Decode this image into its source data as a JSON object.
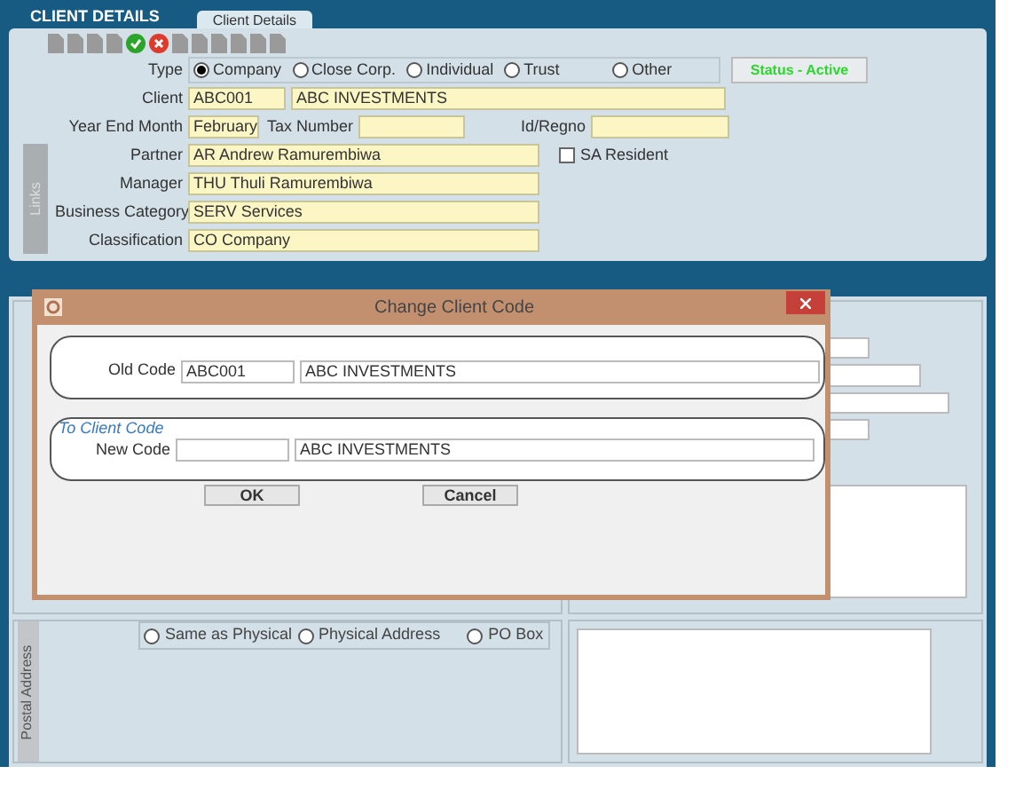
{
  "header": {
    "title": "CLIENT DETAILS",
    "tab": "Client Details"
  },
  "client_form": {
    "type_label": "Type",
    "type_options": [
      {
        "label": "Company",
        "selected": true
      },
      {
        "label": "Close Corp.",
        "selected": false
      },
      {
        "label": "Individual",
        "selected": false
      },
      {
        "label": "Trust",
        "selected": false
      },
      {
        "label": "Other",
        "selected": false
      }
    ],
    "status": "Status - Active",
    "client_label": "Client",
    "client_code": "ABC001",
    "client_name": "ABC INVESTMENTS",
    "year_end_label": "Year End Month",
    "year_end": "February",
    "tax_number_label": "Tax Number",
    "id_label": "Id/Regno",
    "partner_label": "Partner",
    "partner": "AR Andrew Ramurembiwa",
    "sa_resident": {
      "label": "SA Resident",
      "checked": false
    },
    "manager_label": "Manager",
    "manager": "THU Thuli Ramurembiwa",
    "category_label": "Business Category",
    "category": "SERV Services",
    "classification_label": "Classification",
    "classification": "CO Company",
    "links": "Links"
  },
  "dialog": {
    "title": "Change Client Code",
    "old_code_label": "Old Code",
    "old_code": "ABC001",
    "old_name": "ABC INVESTMENTS",
    "section_title": "To Client Code",
    "new_code_label": "New Code",
    "new_name": "ABC INVESTMENTS",
    "buttons": [
      "OK",
      "Cancel"
    ]
  },
  "postal": {
    "label": "Postal Address",
    "options": [
      {
        "label": "Same as Physical",
        "selected": false
      },
      {
        "label": "Physical Address",
        "selected": false
      },
      {
        "label": "PO Box",
        "selected": false
      }
    ]
  }
}
